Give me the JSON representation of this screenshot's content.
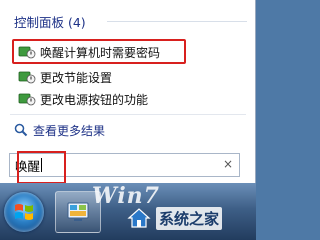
{
  "start_menu": {
    "section_title": "控制面板 (4)",
    "results": [
      {
        "label": "唤醒计算机时需要密码",
        "icon": "power-options-icon"
      },
      {
        "label": "更改节能设置",
        "icon": "power-options-icon"
      },
      {
        "label": "更改电源按钮的功能",
        "icon": "power-options-icon"
      }
    ],
    "see_more": "查看更多结果",
    "search": {
      "value": "唤醒",
      "clear": "×"
    }
  },
  "watermark": {
    "win_text": "Win7",
    "site_text": "系统之家"
  },
  "colors": {
    "highlight": "#d8201e",
    "link": "#1e3287",
    "taskbar": "#3e5f87"
  }
}
